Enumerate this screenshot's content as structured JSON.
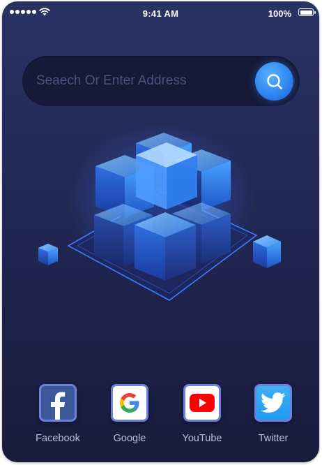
{
  "status_bar": {
    "time": "9:41 AM",
    "battery": "100%",
    "battery_level": 1.0
  },
  "search": {
    "placeholder": "Seaech Or Enter Address",
    "value": ""
  },
  "dock": {
    "apps": [
      {
        "label": "Facebook",
        "icon": "facebook-icon"
      },
      {
        "label": "Google",
        "icon": "google-icon"
      },
      {
        "label": "YouTube",
        "icon": "youtube-icon"
      },
      {
        "label": "Twitter",
        "icon": "twitter-icon"
      }
    ]
  },
  "colors": {
    "background_top": "#2a3265",
    "background_bottom": "#181c3c",
    "search_field": "#161a38",
    "accent_blue": "#2f86f2",
    "label_text": "#b9bfdc"
  }
}
